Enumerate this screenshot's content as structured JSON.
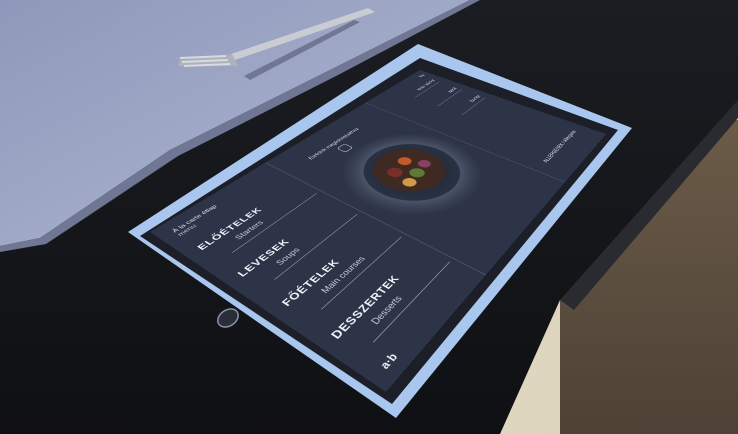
{
  "scene": {
    "colors": {
      "table": "#141518",
      "tablecloth": "#9aa3c2",
      "wall": "#e9e3cf",
      "tablet_frame": "#a9c7ee",
      "screen_bg": "#2e3447"
    },
    "objects": [
      "fork",
      "tablet-in-case",
      "home-button"
    ]
  },
  "tablet": {
    "header_left": "À la carte étlap",
    "header_left_sub": "menu",
    "center_title": "Ételeink megtekintéséhez",
    "menu": [
      {
        "hu": "ELŐÉTELEK",
        "en": "Starters"
      },
      {
        "hu": "LEVESEK",
        "en": "Soups"
      },
      {
        "hu": "FŐÉTELEK",
        "en": "Main courses"
      },
      {
        "hu": "DESSZERTEK",
        "en": "Desserts"
      }
    ],
    "right_items": [
      {
        "label": "Napi ajánlat"
      },
      {
        "label": "Italok"
      },
      {
        "label": "Borlap"
      }
    ],
    "allergen_label": "ALLERGÉNEK / Allergens",
    "logo_text": "a·b",
    "corner_tag": "EN"
  }
}
